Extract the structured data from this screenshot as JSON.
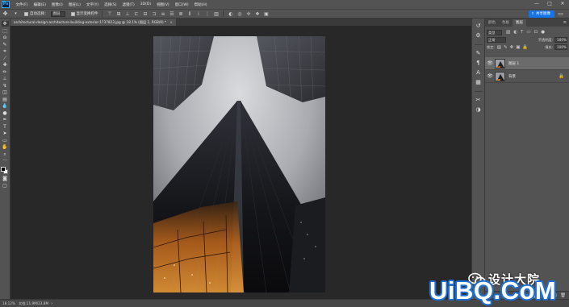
{
  "app": {
    "logo": "Ps"
  },
  "menu": [
    "文件(F)",
    "编辑(E)",
    "图像(I)",
    "图层(L)",
    "文字(Y)",
    "选择(S)",
    "滤镜(T)",
    "3D(D)",
    "视图(V)",
    "窗口(W)",
    "帮助(H)"
  ],
  "window_controls": {
    "minimize": "—",
    "maximize": "□",
    "close": "✕"
  },
  "options": {
    "auto_select_label": "自动选择：",
    "auto_select_value": "图层",
    "show_transform_label": "显示变换控件",
    "share_label": "共享图像"
  },
  "document_tab": {
    "title": "architectural-design-architecture-building-exterior-1737823.jpg @ 18.1% (图层 1, RGB/8) *",
    "close": "×"
  },
  "status": {
    "zoom": "18.12%",
    "doc_info": "文档:11.9M/23.8M",
    "arrow": "›"
  },
  "layers_panel": {
    "tabs": [
      "颜色",
      "色板",
      "图层"
    ],
    "active_tab": 2,
    "menu_icon": "≡",
    "filter_kind": "类型",
    "blend_mode": "正常",
    "opacity_label": "不透明度:",
    "opacity_value": "100%",
    "lock_label": "锁定:",
    "fill_label": "填充:",
    "fill_value": "100%",
    "layers": [
      {
        "name": "图层 1",
        "visible": true,
        "selected": true
      },
      {
        "name": "背景",
        "visible": true,
        "selected": false,
        "locked": true
      }
    ]
  },
  "watermarks": {
    "wechat": "设计大院",
    "site": "UiBQ.CoM"
  },
  "colors": {
    "ui_bg": "#535353",
    "canvas_bg": "#282828",
    "accent": "#1473e6"
  }
}
